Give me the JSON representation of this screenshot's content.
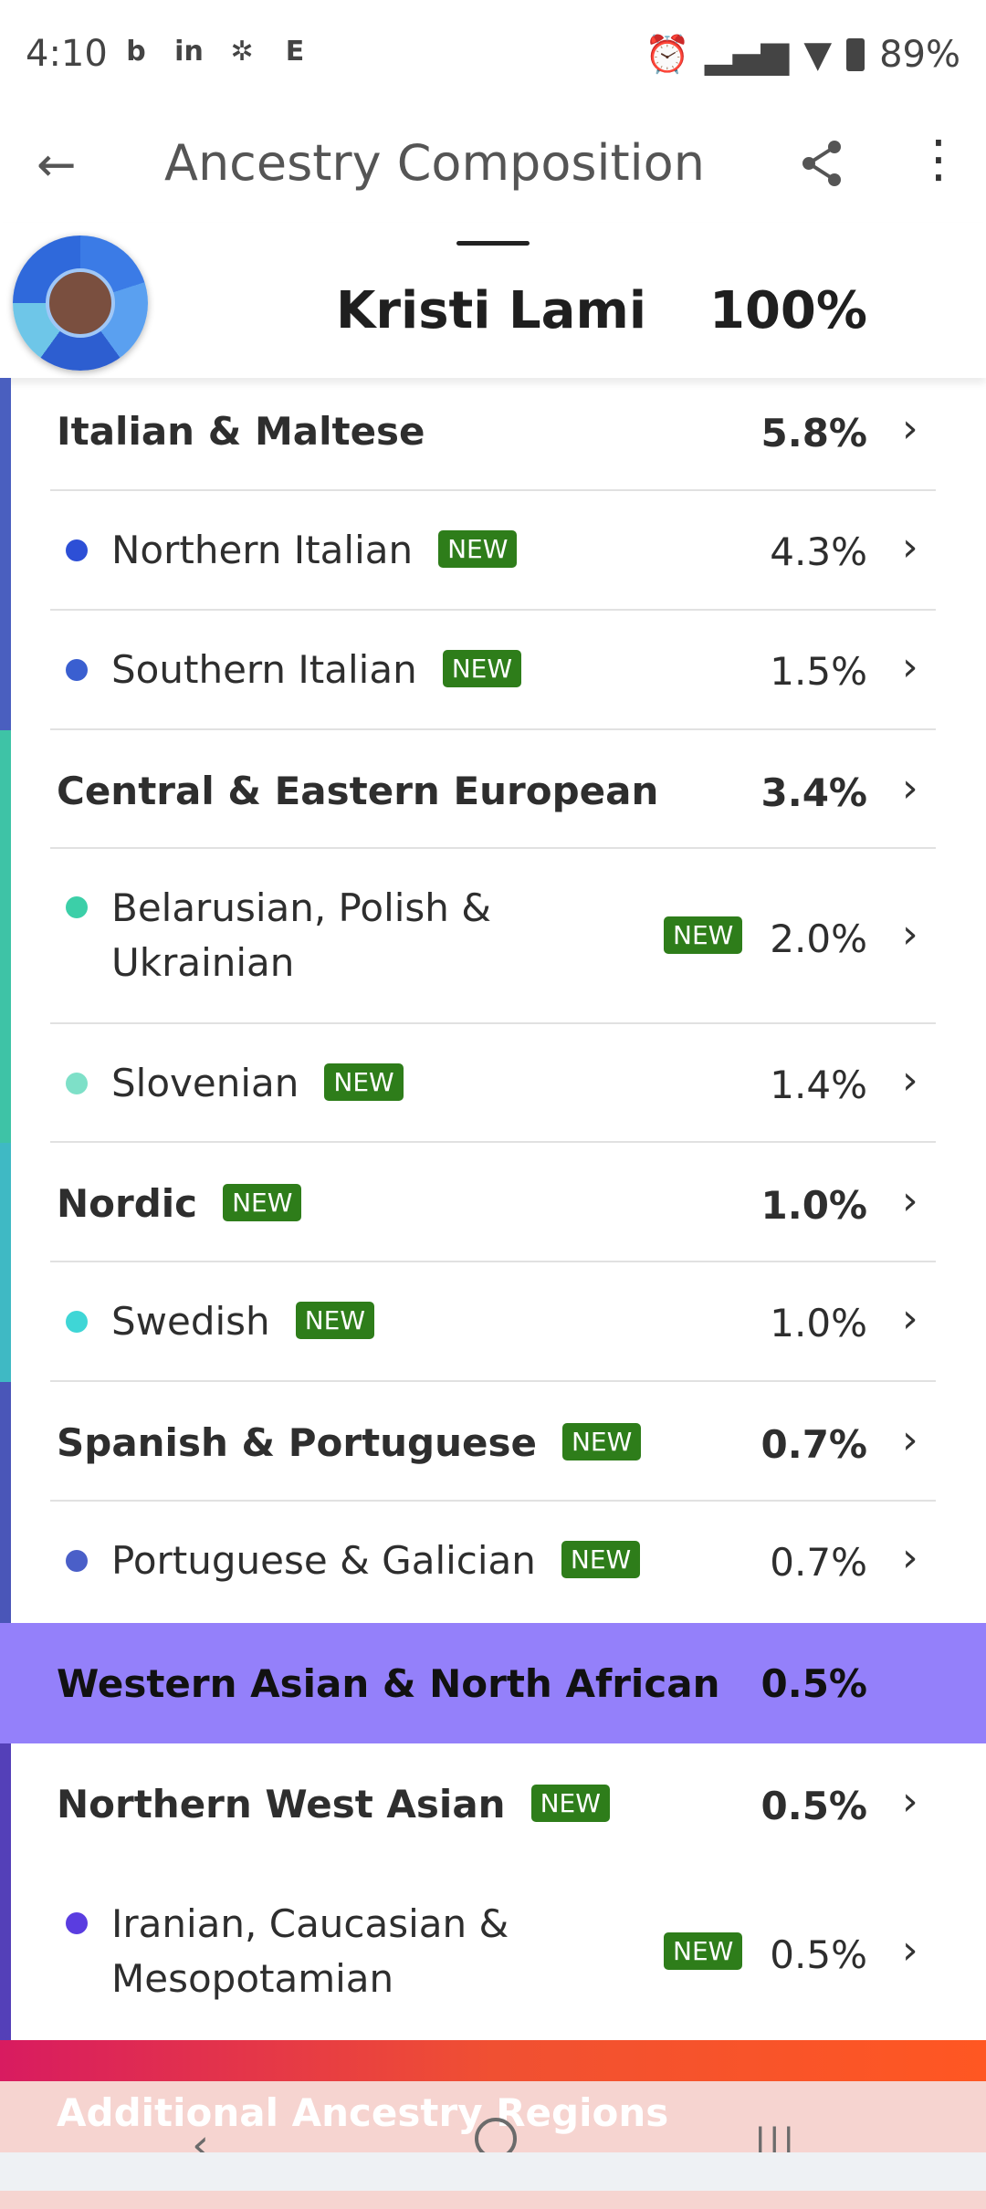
{
  "status_bar": {
    "time": "4:10",
    "battery": "89%",
    "app_icons": [
      "b",
      "in",
      "✲",
      "E"
    ]
  },
  "app_bar": {
    "title": "Ancestry Composition",
    "icons": [
      "back-arrow-icon",
      "share-icon",
      "more-vert-icon"
    ]
  },
  "profile": {
    "name": "Kristi Lami",
    "percent": "100%"
  },
  "badge_text": "NEW",
  "rows": [
    {
      "label": "Italian & Maltese",
      "percent": "5.8%",
      "level": "group",
      "new": false
    },
    {
      "label": "Northern Italian",
      "percent": "4.3%",
      "level": "sub",
      "new": true,
      "dot_color": "#2d4fd6"
    },
    {
      "label": "Southern Italian",
      "percent": "1.5%",
      "level": "sub",
      "new": true,
      "dot_color": "#3a5fd0"
    },
    {
      "label": "Central & Eastern European",
      "percent": "3.4%",
      "level": "group",
      "new": false
    },
    {
      "label_line1": "Belarusian, Polish &",
      "label_line2": "Ukrainian",
      "percent": "2.0%",
      "level": "sub",
      "new": true,
      "dot_color": "#3ccfa8"
    },
    {
      "label": "Slovenian",
      "percent": "1.4%",
      "level": "sub",
      "new": true,
      "dot_color": "#7ee0c8"
    },
    {
      "label": "Nordic",
      "percent": "1.0%",
      "level": "group",
      "new": true
    },
    {
      "label": "Swedish",
      "percent": "1.0%",
      "level": "sub",
      "new": true,
      "dot_color": "#3fd6d6"
    },
    {
      "label": "Spanish & Portuguese",
      "percent": "0.7%",
      "level": "group",
      "new": true
    },
    {
      "label": "Portuguese & Galician",
      "percent": "0.7%",
      "level": "sub",
      "new": true,
      "dot_color": "#4a5fc8"
    },
    {
      "label": "Western Asian & North African",
      "percent": "0.5%",
      "level": "highlight",
      "new": false
    },
    {
      "label": "Northern West Asian",
      "percent": "0.5%",
      "level": "group",
      "new": true
    },
    {
      "label_line1": "Iranian, Caucasian &",
      "label_line2": "Mesopotamian",
      "percent": "0.5%",
      "level": "sub",
      "new": true,
      "dot_color": "#5a3de0"
    }
  ],
  "additional_section": "Additional Ancestry Regions",
  "colors": {
    "highlight": "#9480fa",
    "badge": "#2e7d1a",
    "stripe_italian": "#4a5fbf",
    "stripe_central": "#3ec3a6",
    "stripe_nordic": "#3fb9c4",
    "stripe_spanish": "#4a56b8",
    "stripe_west_asian": "#5440b8"
  }
}
